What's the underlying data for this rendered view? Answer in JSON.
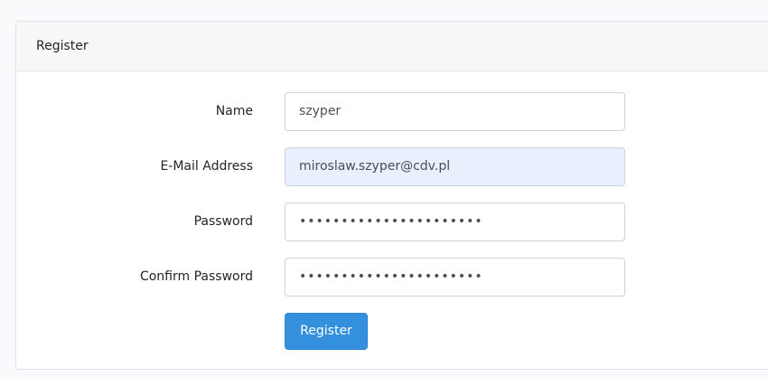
{
  "card": {
    "title": "Register"
  },
  "form": {
    "name": {
      "label": "Name",
      "value": "szyper"
    },
    "email": {
      "label": "E-Mail Address",
      "value": "miroslaw.szyper@cdv.pl"
    },
    "password": {
      "label": "Password",
      "value": "••••••••••••••••••••••"
    },
    "confirm_password": {
      "label": "Confirm Password",
      "value": "••••••••••••••••••••••"
    },
    "submit_label": "Register"
  },
  "colors": {
    "primary": "#3490dc",
    "autofill": "#e8f0fe"
  }
}
